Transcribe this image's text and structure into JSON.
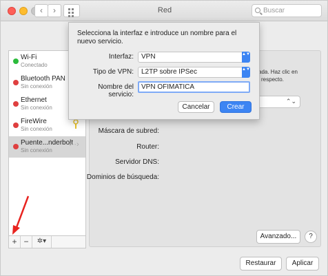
{
  "window": {
    "title": "Red",
    "search_placeholder": "Buscar",
    "back_glyph": "‹",
    "forward_glyph": "›"
  },
  "sidebar": {
    "items": [
      {
        "name": "Wi-Fi",
        "status": "Conectado",
        "status_color": "#2bbb3b",
        "selected": false
      },
      {
        "name": "Bluetooth PAN",
        "status": "Sin conexión",
        "status_color": "#df3f3f",
        "selected": false
      },
      {
        "name": "Ethernet",
        "status": "Sin conexión",
        "status_color": "#df3f3f",
        "selected": false
      },
      {
        "name": "FireWire",
        "status": "Sin conexión",
        "status_color": "#df3f3f",
        "selected": false
      },
      {
        "name": "Puente...nderbolt",
        "status": "Sin conexión",
        "status_color": "#df3f3f",
        "selected": true
      }
    ],
    "add_glyph": "+",
    "remove_glyph": "−",
    "gear_glyph": "✲▾",
    "thunderbolt_glyph": "‹··›"
  },
  "detail": {
    "hint_line1": "ada. Haz clic en",
    "hint_line2": "l respecto.",
    "popup_glyph": "⌃⌄",
    "fields": [
      {
        "label": "Máscara de subred:"
      },
      {
        "label": "Router:"
      },
      {
        "label": "Servidor DNS:"
      },
      {
        "label": "Dominios de búsqueda:"
      }
    ],
    "advanced_label": "Avanzado...",
    "help_label": "?",
    "revert_label": "Restaurar",
    "apply_label": "Aplicar"
  },
  "sheet": {
    "prompt": "Selecciona la interfaz e introduce un nombre para el nuevo servicio.",
    "interface_label": "Interfaz:",
    "interface_value": "VPN",
    "vpn_type_label": "Tipo de VPN:",
    "vpn_type_value": "L2TP sobre IPSec",
    "service_name_label": "Nombre del servicio:",
    "service_name_value": "VPN OFIMATICA",
    "cancel_label": "Cancelar",
    "create_label": "Crear",
    "stepper_glyph": "▲▼"
  },
  "annotation": {
    "arrow_color": "#e8231f"
  }
}
